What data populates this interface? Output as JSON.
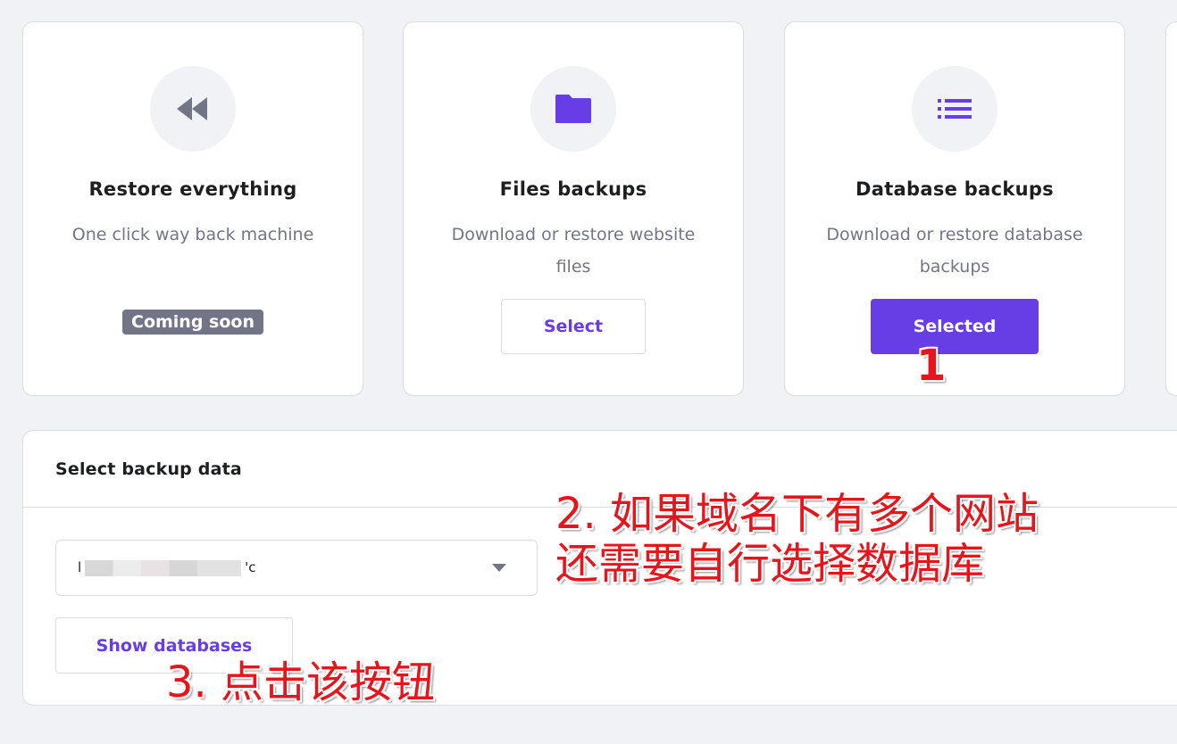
{
  "colors": {
    "accent": "#673de6",
    "muted": "#727586",
    "background": "#f1f2f6",
    "annotation": "#e8141c"
  },
  "cards": [
    {
      "icon": "rewind-icon",
      "title": "Restore everything",
      "description": "One click way back machine",
      "badge": "Coming soon"
    },
    {
      "icon": "folder-icon",
      "title": "Files backups",
      "description": "Download or restore website files",
      "button": "Select"
    },
    {
      "icon": "list-icon",
      "title": "Database backups",
      "description": "Download or restore database backups",
      "button": "Selected"
    }
  ],
  "panel": {
    "title": "Select backup data",
    "select": {
      "value_prefix": "l",
      "value_suffix": "'c"
    },
    "show_button": "Show databases"
  },
  "annotations": {
    "step1": "1",
    "step2_line1": "2. 如果域名下有多个网站",
    "step2_line2": "还需要自行选择数据库",
    "step3": "3. 点击该按钮"
  }
}
